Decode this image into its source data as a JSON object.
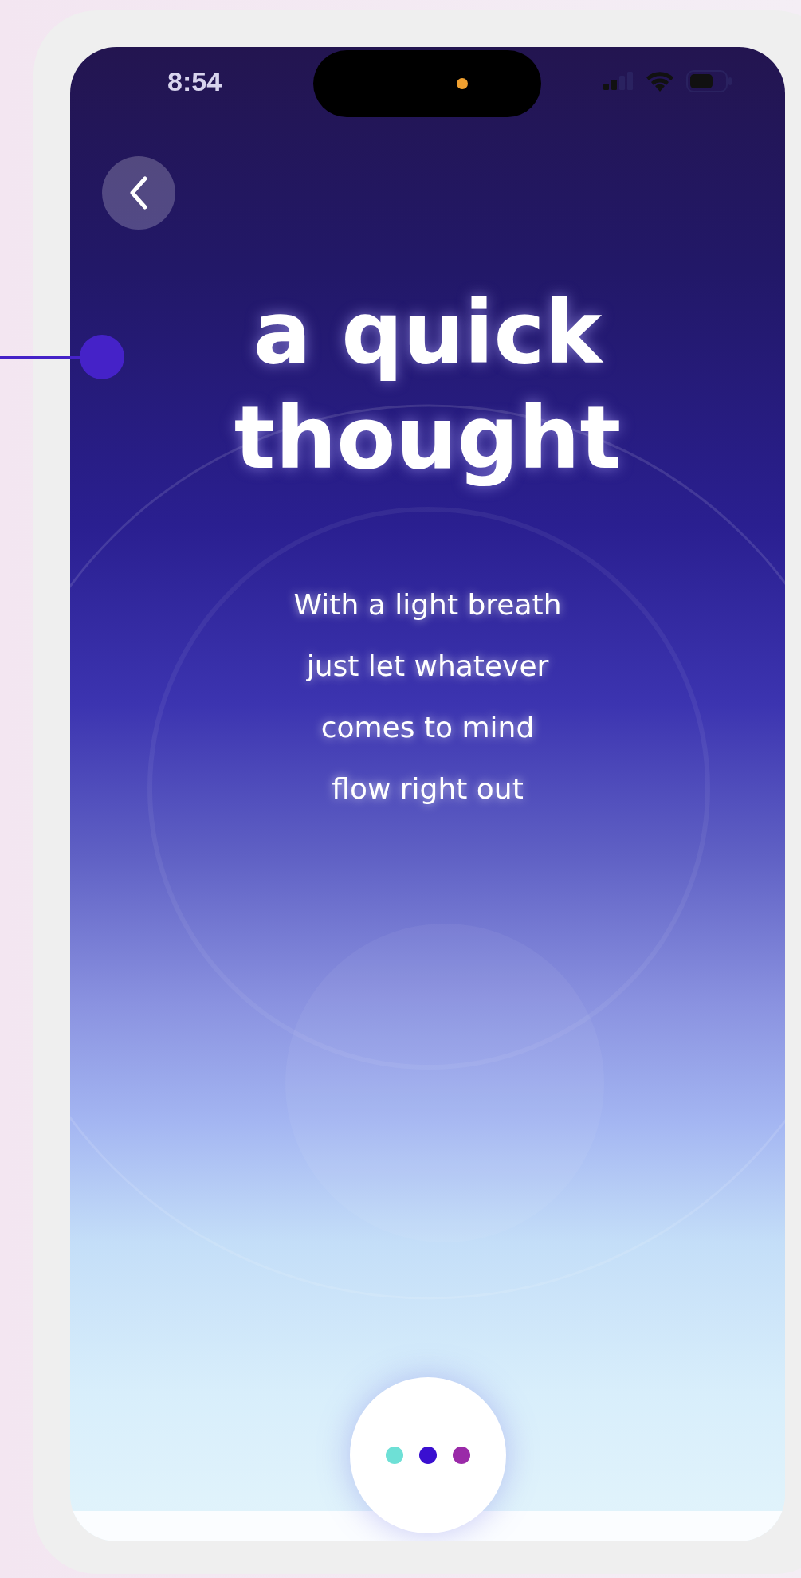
{
  "status_bar": {
    "time": "8:54"
  },
  "title": "a quick thought",
  "message_lines": [
    "With a light breath",
    "just let whatever",
    "comes to mind",
    "flow right out"
  ],
  "menu_button": {
    "dots": [
      {
        "color": "#6ee0d6"
      },
      {
        "color": "#3a0fd0"
      },
      {
        "color": "#9a2aa8"
      }
    ]
  }
}
